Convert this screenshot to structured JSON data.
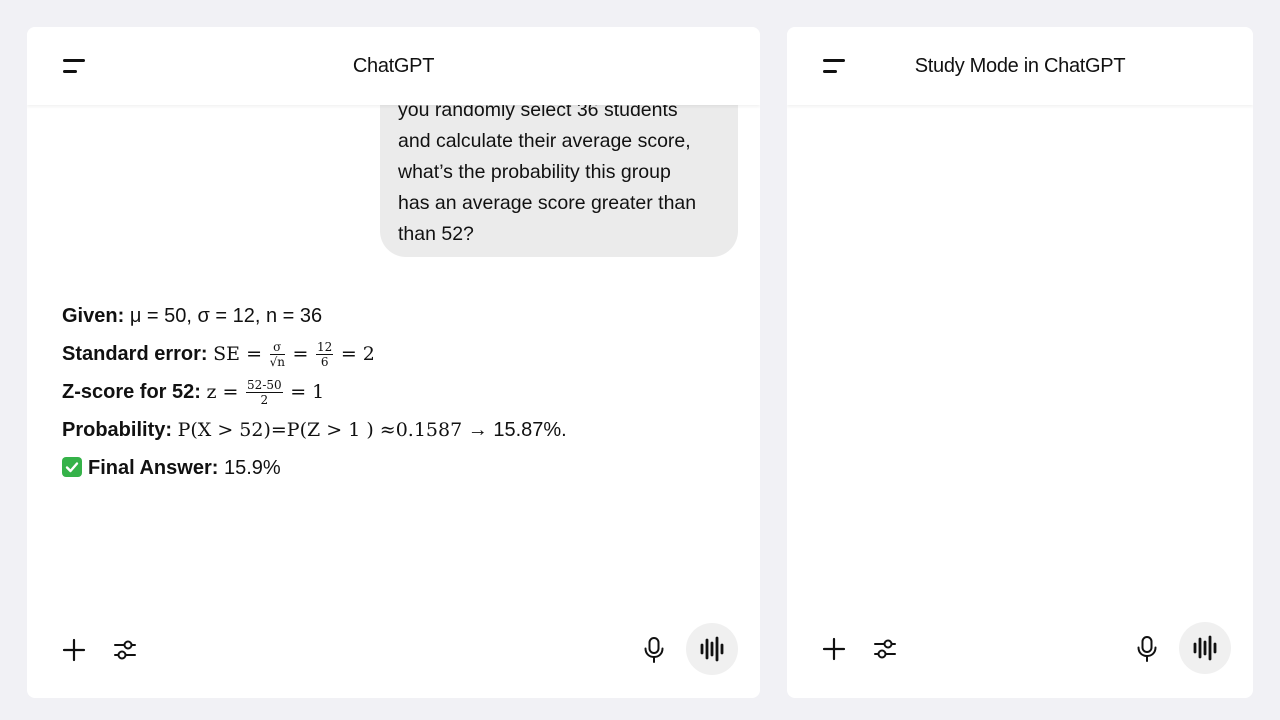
{
  "left_panel": {
    "title": "ChatGPT",
    "user_message_lines": [
      "you randomly select 36 students",
      "and calculate their average score,",
      "what’s the probability this group",
      "has an average score greater than",
      "than 52?"
    ],
    "answer": {
      "given_label": "Given:",
      "given_value": "μ = 50, σ = 12, n = 36",
      "se_label": "Standard error:",
      "se_lhs": "SE =",
      "se_frac1_num": "σ",
      "se_frac1_den": "√n",
      "se_eq": "=",
      "se_frac2_num": "12",
      "se_frac2_den": "6",
      "se_result": "= 2",
      "z_label": "Z-score for 52:",
      "z_lhs": "z =",
      "z_frac_num": "52-50",
      "z_frac_den": "2",
      "z_result": "= 1",
      "prob_label": "Probability:",
      "prob_math": "P(X > 52)=P(Z > 1 ) ≈0.1587",
      "prob_tail": " → 15.87%.",
      "final_label": "Final Answer:",
      "final_value": "15.9%"
    }
  },
  "right_panel": {
    "title": "Study Mode in ChatGPT"
  },
  "icons": {
    "menu": "hamburger-menu-icon",
    "add": "plus-icon",
    "tools": "sliders-icon",
    "mic": "microphone-icon",
    "voice": "voice-waveform-icon",
    "check": "check-mark-icon"
  },
  "colors": {
    "background": "#f1f1f5",
    "panel": "#ffffff",
    "bubble": "#ebebeb",
    "check": "#35b249"
  }
}
